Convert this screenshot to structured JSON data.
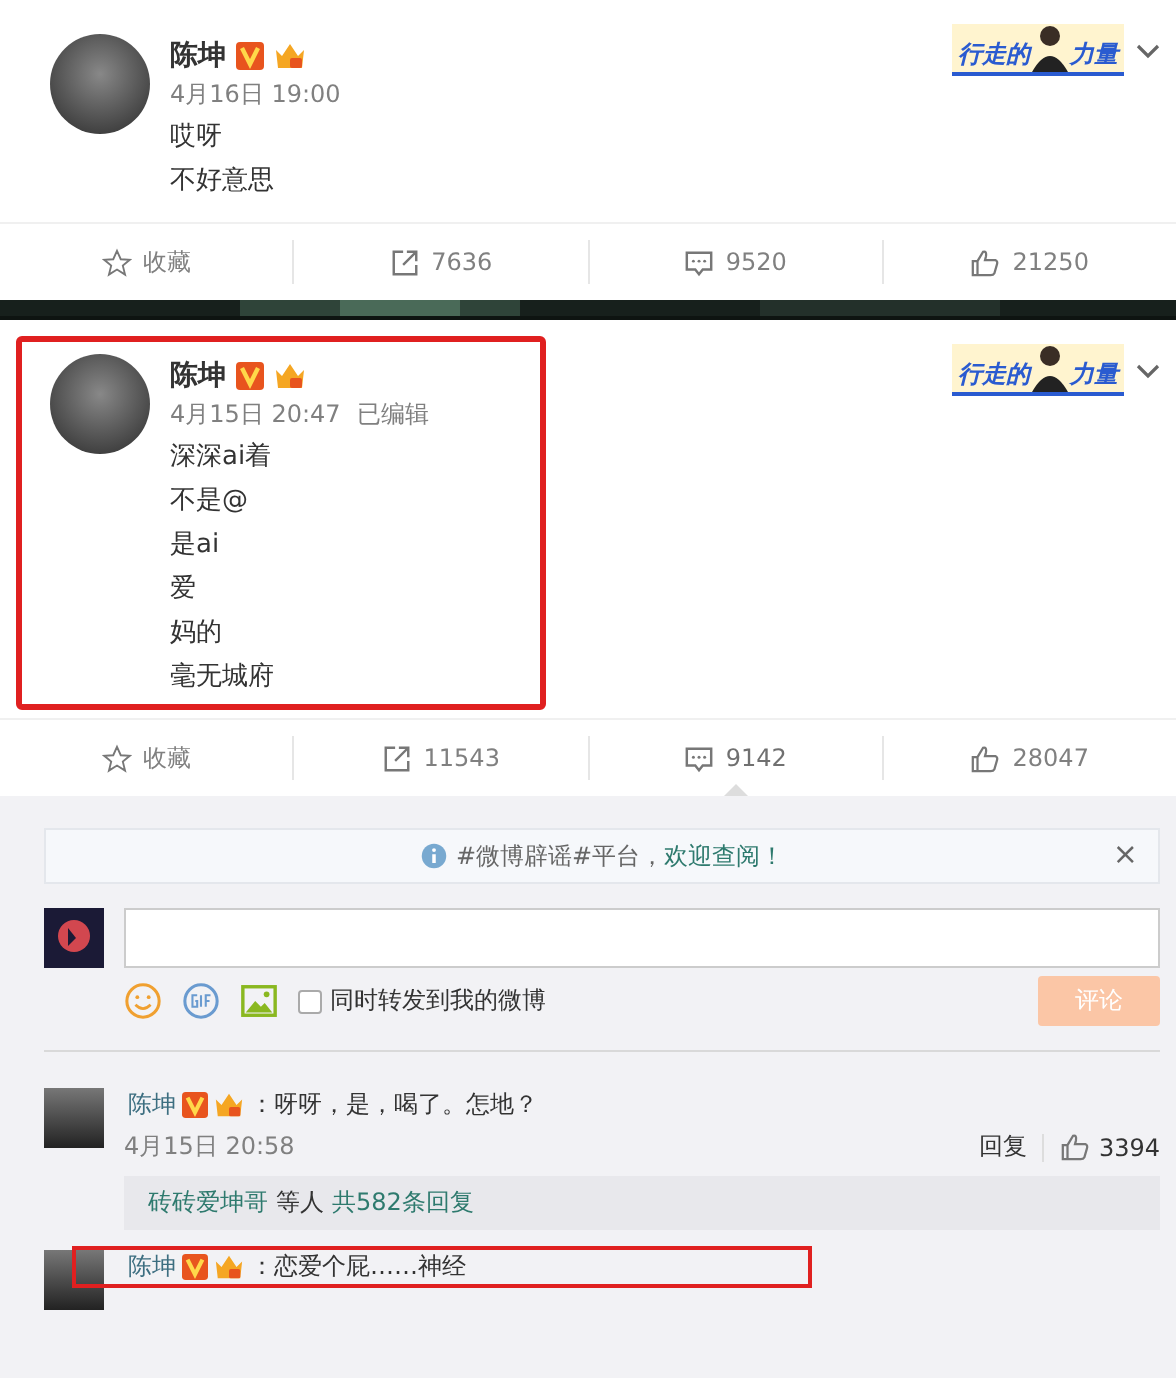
{
  "posts": [
    {
      "author": "陈坤",
      "time": "4月16日 19:00",
      "lines": [
        "哎呀",
        "不好意思"
      ],
      "highlighted": false,
      "badge": [
        "行走的",
        "力量"
      ],
      "actions": [
        {
          "kind": "favorite",
          "label": "收藏",
          "selected": false
        },
        {
          "kind": "repost",
          "label": "7636",
          "selected": false
        },
        {
          "kind": "comment",
          "label": "9520",
          "selected": false
        },
        {
          "kind": "like",
          "label": "21250",
          "selected": false
        }
      ]
    },
    {
      "author": "陈坤",
      "time": "4月15日 20:47",
      "edited": "已编辑",
      "lines": [
        "深深ai着",
        "不是@",
        "是ai",
        "爱",
        "妈的",
        "毫无城府"
      ],
      "highlighted": true,
      "badge": [
        "行走的",
        "力量"
      ],
      "actions": [
        {
          "kind": "favorite",
          "label": "收藏",
          "selected": false
        },
        {
          "kind": "repost",
          "label": "11543",
          "selected": false
        },
        {
          "kind": "comment",
          "label": "9142",
          "selected": true
        },
        {
          "kind": "like",
          "label": "28047",
          "selected": false
        }
      ]
    }
  ],
  "notice": {
    "text": "#微博辟谣#平台，",
    "link": "欢迎查阅！",
    "close": "×"
  },
  "composer": {
    "repost_label": "同时转发到我的微博",
    "repost_checked": false,
    "submit": "评论",
    "submit_disabled": true
  },
  "comments": [
    {
      "author": "陈坤",
      "text": "：呀呀，是，喝了。怎地？",
      "time": "4月15日 20:58",
      "reply": "回复",
      "likes": "3394",
      "highlighted": false,
      "replies": {
        "users": "砖砖爱坤哥",
        "middle": "等人",
        "count": "共582条回复"
      }
    },
    {
      "author": "陈坤",
      "text": "：恋爱个屁……神经",
      "highlighted": true
    }
  ]
}
